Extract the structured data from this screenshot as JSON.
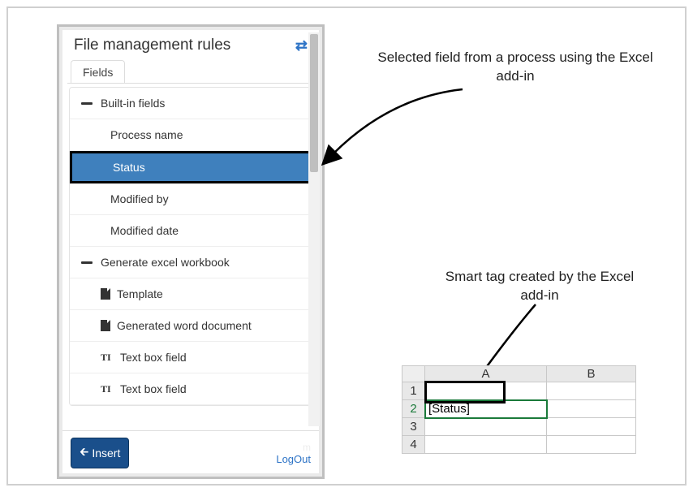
{
  "pane": {
    "title": "File management rules",
    "tab_label": "Fields",
    "groups": [
      {
        "label": "Built-in fields",
        "items": [
          {
            "label": "Process name",
            "selected": false
          },
          {
            "label": "Status",
            "selected": true
          },
          {
            "label": "Modified by",
            "selected": false
          },
          {
            "label": "Modified date",
            "selected": false
          }
        ]
      },
      {
        "label": "Generate excel workbook",
        "items": [
          {
            "label": "Template",
            "icon": "file"
          },
          {
            "label": "Generated word document",
            "icon": "file"
          },
          {
            "label": "Text box field",
            "icon": "text"
          },
          {
            "label": "Text box field",
            "icon": "text"
          }
        ]
      }
    ],
    "footer": {
      "insert_label": "Insert",
      "logout_label": "LogOut"
    }
  },
  "annotations": {
    "selected_field": "Selected field from a process using the Excel add-in",
    "smart_tag": "Smart tag created by the Excel add-in"
  },
  "grid": {
    "columns": [
      "A",
      "B"
    ],
    "rows": [
      "1",
      "2",
      "3",
      "4"
    ],
    "selected_cell": {
      "row": 2,
      "col": "A",
      "value": "[Status]"
    }
  }
}
